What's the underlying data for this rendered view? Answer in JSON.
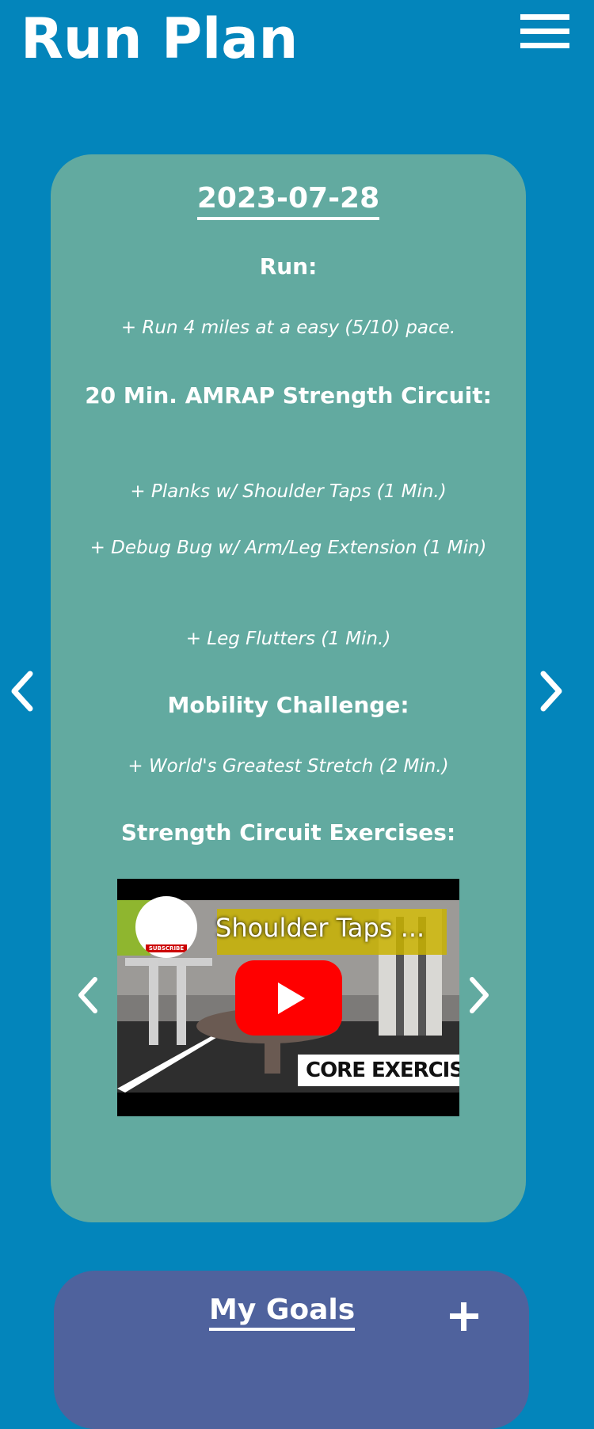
{
  "header": {
    "title": "Run Plan",
    "menu_icon": "hamburger-menu-icon"
  },
  "plan": {
    "date": "2023-07-28",
    "sections": [
      {
        "heading": "Run:",
        "items": [
          "+ Run 4 miles at a easy (5/10) pace."
        ]
      },
      {
        "heading": "20 Min. AMRAP Strength Circuit:",
        "items": [
          "+ Planks w/ Shoulder Taps (1 Min.)",
          "+ Debug Bug w/ Arm/Leg Extension (1 Min)",
          "+ Leg Flutters (1 Min.)"
        ]
      },
      {
        "heading": "Mobility Challenge:",
        "items": [
          "+ World's Greatest Stretch (2 Min.)"
        ]
      },
      {
        "heading": "Strength Circuit Exercises:",
        "items": []
      }
    ],
    "prev_icon": "chevron-left-icon",
    "next_icon": "chevron-right-icon"
  },
  "video": {
    "title": "Shoulder Taps ...",
    "caption": "CORE EXERCISE",
    "channel_label": "SUBSCRIBE",
    "play_icon": "youtube-play-icon",
    "prev_icon": "chevron-left-icon",
    "next_icon": "chevron-right-icon"
  },
  "goals": {
    "title": "My Goals",
    "add_icon": "plus-icon"
  },
  "colors": {
    "background": "#0385bb",
    "plan_card": "#62aaa0",
    "goals_card": "#4f629d",
    "play_button": "#ff0000",
    "text": "#ffffff"
  }
}
